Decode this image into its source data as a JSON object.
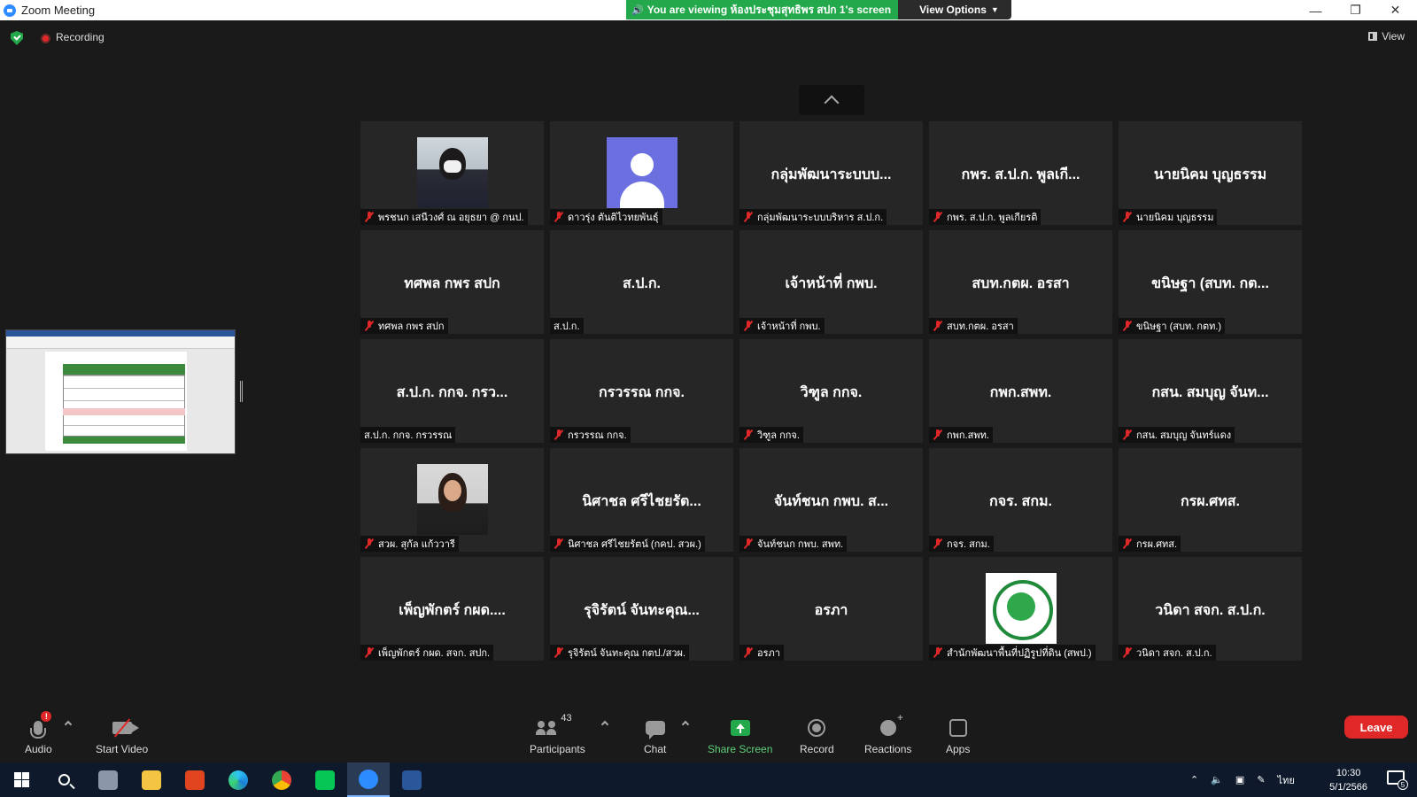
{
  "window": {
    "title": "Zoom Meeting",
    "minimize_icon": "minimize-icon",
    "restore_icon": "restore-icon",
    "close_icon": "close-icon"
  },
  "share_banner": {
    "viewing_text": "You are viewing ห้องประชุมสุทธิพร สปก 1's screen",
    "view_options": "View Options",
    "colors": {
      "green": "#23a94b"
    }
  },
  "status": {
    "recording": "Recording",
    "view": "View"
  },
  "participants": [
    {
      "display": "",
      "tag": "พรชนก เสนีวงศ์ ณ อยุธยา @ กนป.",
      "muted": true,
      "picture": "woman1"
    },
    {
      "display": "",
      "tag": "ดาวรุ่ง ตันติไวทยพันธุ์",
      "muted": true,
      "picture": "avatar"
    },
    {
      "display": "กลุ่มพัฒนาระบบบ...",
      "tag": "กลุ่มพัฒนาระบบบริหาร ส.ป.ก.",
      "muted": true
    },
    {
      "display": "กพร. ส.ป.ก. พูลเกี...",
      "tag": "กพร. ส.ป.ก. พูลเกียรติ",
      "muted": true
    },
    {
      "display": "นายนิคม บุญธรรม",
      "tag": "นายนิคม บุญธรรม",
      "muted": true
    },
    {
      "display": "ทศพล กพร สปก",
      "tag": "ทศพล กพร สปก",
      "muted": true
    },
    {
      "display": "ส.ป.ก.",
      "tag": "ส.ป.ก.",
      "muted": false
    },
    {
      "display": "เจ้าหน้าที่ กพบ.",
      "tag": "เจ้าหน้าที่ กพบ.",
      "muted": true
    },
    {
      "display": "สบท.กตผ. อรสา",
      "tag": "สบท.กตผ. อรสา",
      "muted": true
    },
    {
      "display": "ขนิษฐา (สบท. กต...",
      "tag": "ขนิษฐา (สบท. กตท.)",
      "muted": true
    },
    {
      "display": "ส.ป.ก. กกจ. กรว...",
      "tag": "ส.ป.ก. กกจ. กรวรรณ",
      "muted": false
    },
    {
      "display": "กรวรรณ กกจ.",
      "tag": "กรวรรณ กกจ.",
      "muted": true
    },
    {
      "display": "วิฑูล กกจ.",
      "tag": "วิฑูล กกจ.",
      "muted": true
    },
    {
      "display": "กพก.สพท.",
      "tag": "กพก.สพท.",
      "muted": true
    },
    {
      "display": "กสน. สมบุญ จันท...",
      "tag": "กสน. สมบุญ จันทร์แดง",
      "muted": true
    },
    {
      "display": "",
      "tag": "สวผ. สุกัล แก้ววารี",
      "muted": true,
      "picture": "woman2"
    },
    {
      "display": "นิศาชล ศรีไชยรัต...",
      "tag": "นิศาชล ศรีไชยรัตน์ (กคป. สวผ.)",
      "muted": true
    },
    {
      "display": "จันท์ชนก กพบ. ส...",
      "tag": "จันท์ชนก กพบ. สพท.",
      "muted": true
    },
    {
      "display": "กจร. สกม.",
      "tag": "กจร. สกม.",
      "muted": true
    },
    {
      "display": "กรผ.ศทส.",
      "tag": "กรผ.ศทส.",
      "muted": true
    },
    {
      "display": "เพ็ญพักตร์ กผด....",
      "tag": "เพ็ญพักตร์ กผด. สจก. สปก.",
      "muted": true
    },
    {
      "display": "รุจิรัตน์ จันทะคุณ...",
      "tag": "รุจิรัตน์ จันทะคุณ กตป./สวผ.",
      "muted": true
    },
    {
      "display": "อรภา",
      "tag": "อรภา",
      "muted": true
    },
    {
      "display": "",
      "tag": "สำนักพัฒนาพื้นที่ปฏิรูปที่ดิน (สพป.)",
      "muted": true,
      "picture": "logo"
    },
    {
      "display": "วนิดา สจก. ส.ป.ก.",
      "tag": "วนิดา สจก. ส.ป.ก.",
      "muted": true
    }
  ],
  "controls": {
    "audio": "Audio",
    "audio_alert": "!",
    "start_video": "Start Video",
    "participants": "Participants",
    "participant_count": "43",
    "chat": "Chat",
    "share_screen": "Share Screen",
    "record": "Record",
    "reactions": "Reactions",
    "apps": "Apps",
    "leave": "Leave",
    "colors": {
      "leave": "#e02828",
      "share": "#23a94b"
    }
  },
  "taskbar": {
    "language": "ไทย",
    "time": "10:30",
    "date": "5/1/2566",
    "notification_count": "5",
    "apps": [
      "windows-start-icon",
      "search-icon",
      "zoom-app-icon",
      "file-explorer-icon",
      "office-icon",
      "edge-icon",
      "chrome-icon",
      "line-icon",
      "zoom-icon",
      "word-icon"
    ]
  }
}
